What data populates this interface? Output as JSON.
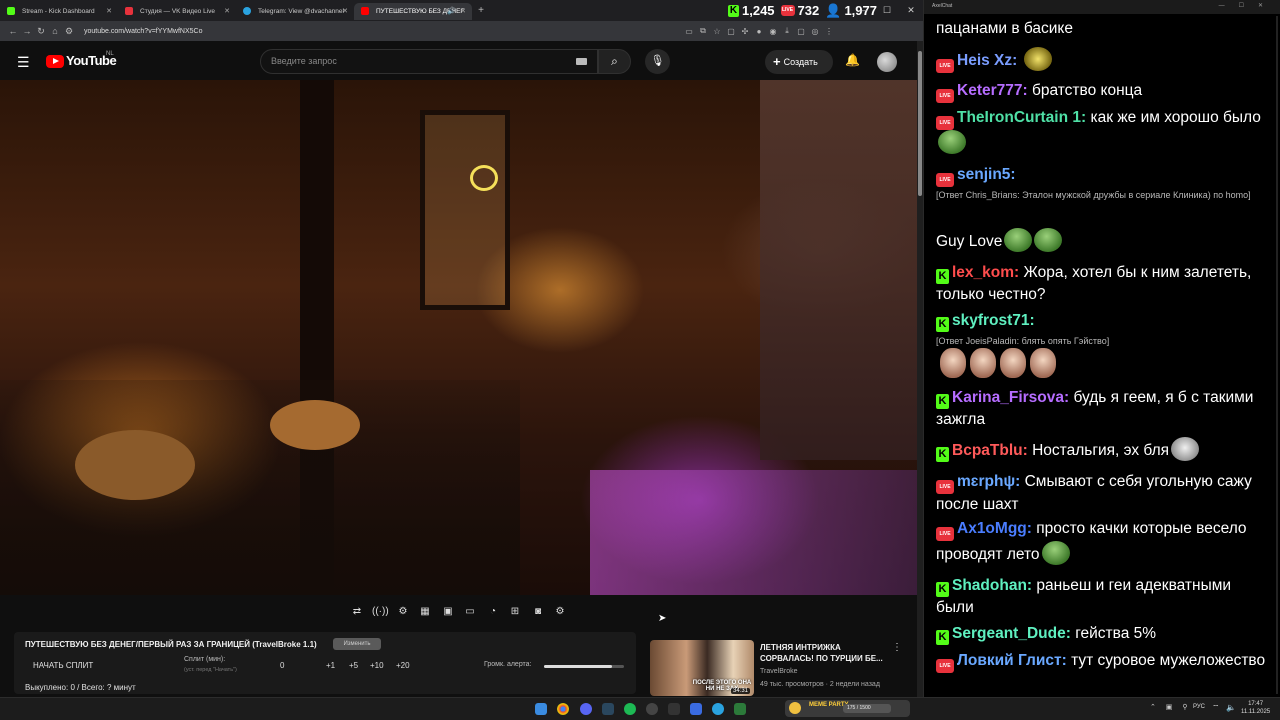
{
  "browser": {
    "tabs": [
      {
        "label": "Stream - Kick Dashboard",
        "color": "#53fc18",
        "active": false
      },
      {
        "label": "Студия — VK Видео Live",
        "color": "#e8323c",
        "active": false
      },
      {
        "label": "Telegram: View @dvachannel",
        "color": "#2aa3e0",
        "active": false
      },
      {
        "label": "ПУТЕШЕСТВУЮ БЕЗ ДЕНЕГ",
        "color": "#ff0000",
        "active": true
      }
    ],
    "url": "youtube.com/watch?v=fYYMwfNX5Co",
    "stats": {
      "kick": "1,245",
      "vk": "732",
      "viewers": "1,977"
    }
  },
  "youtube": {
    "logo": "YouTube",
    "region": "NL",
    "search_placeholder": "Введите запрос",
    "create_label": "Создать"
  },
  "split": {
    "title": "ПУТЕШЕСТВУЮ БЕЗ ДЕНЕГ/ПЕРВЫЙ РАЗ ЗА ГРАНИЦЕЙ (TravelBroke 1.1)",
    "badge": "Изменить",
    "start_label": "НАЧАТЬ СПЛИТ",
    "split_label": "Сплит (мин):",
    "split_sub": "(уст. перед \"Начать\")",
    "split_value": "0",
    "increments": [
      "+1",
      "+5",
      "+10",
      "+20"
    ],
    "alert_label": "Громк. алерта:",
    "alert_volume": 0.85,
    "bought": "Выкуплено: 0 / Всего: ? минут"
  },
  "recommendation": {
    "title": "ЛЕТНЯЯ ИНТРИЖКА СОРВАЛАСЬ! ПО ТУРЦИИ БЕ...",
    "channel": "TravelBroke",
    "meta": "49 тыс. просмотров · 2 недели назад",
    "duration": "34:31",
    "thumb_text": "ПОСЛЕ ЭТОГО ОНА НИ НЕ ЗАХ"
  },
  "chat": {
    "window_title": "AxelChat",
    "messages": [
      {
        "platform": "",
        "nick": "",
        "nick_color": "#ffffff",
        "text": "пацанами в басике",
        "emotes": []
      },
      {
        "platform": "vk",
        "nick": "Heis Xz:",
        "nick_color": "#7a9dff",
        "text": "",
        "emotes": [
          "coin"
        ]
      },
      {
        "platform": "vk",
        "nick": "Keter777:",
        "nick_color": "#b66dff",
        "text": "братство конца",
        "emotes": []
      },
      {
        "platform": "vk",
        "nick": "TheIronCurtain 1:",
        "nick_color": "#4fe0a6",
        "text": "как же им хорошо было",
        "emotes": [
          "pepe"
        ]
      },
      {
        "platform": "vk",
        "nick": "senjin5:",
        "nick_color": "#6aa8ff",
        "text": "",
        "emotes": []
      },
      {
        "platform": "",
        "nick": "",
        "nick_color": "#ffffff",
        "text": "Guy Love",
        "emotes": [
          "pepe",
          "pepe"
        ]
      },
      {
        "platform": "kick",
        "nick": "lex_kom:",
        "nick_color": "#ff4d4d",
        "text": "Жора, хотел бы к ним залететь, только честно?",
        "emotes": []
      },
      {
        "platform": "kick",
        "nick": "skyfrost71:",
        "nick_color": "#5ff0c0",
        "text": "",
        "emotes": []
      },
      {
        "platform": "",
        "nick": "",
        "nick_color": "#ffffff",
        "text": "",
        "emotes": [
          "face",
          "face",
          "face",
          "face"
        ]
      },
      {
        "platform": "kick",
        "nick": "Karina_Firsova:",
        "nick_color": "#b66dff",
        "text": "будь я геем, я б с такими зажгла",
        "emotes": []
      },
      {
        "platform": "kick",
        "nick": "BcpaTblu:",
        "nick_color": "#ff5a5a",
        "text": "Ностальгия, эх бля",
        "emotes": [
          "cat"
        ]
      },
      {
        "platform": "vk",
        "nick": "mɛrphψ:",
        "nick_color": "#6aa8ff",
        "text": "Смывают с себя угольную сажу после шахт",
        "emotes": []
      },
      {
        "platform": "vk",
        "nick": "Ax1oMgg:",
        "nick_color": "#4a7dff",
        "text": "просто качки которые весело проводят лето",
        "emotes": [
          "pepe"
        ]
      },
      {
        "platform": "kick",
        "nick": "Shadohan:",
        "nick_color": "#5ff0c0",
        "text": "раньеш и геи адекватными были",
        "emotes": []
      },
      {
        "platform": "kick",
        "nick": "Sergeant_Dude:",
        "nick_color": "#5ff0c0",
        "text": "гейства 5%",
        "emotes": []
      },
      {
        "platform": "vk",
        "nick": "Ловкий Глист:",
        "nick_color": "#6aa8ff",
        "text": "тут суровое мужеложество",
        "emotes": []
      }
    ],
    "replies": [
      {
        "text": "[Ответ Chris_Brians: Эталон мужской дружбы в сериале Клиника) по homo]"
      },
      {
        "text": "[Ответ JoeisPaladin: блять опять Гэйство]"
      }
    ]
  },
  "taskbar": {
    "widget_title": "MEME PARTY",
    "widget_count": "175 / 1500",
    "lang": "РУС",
    "time": "17:47",
    "date": "11.11.2025"
  }
}
